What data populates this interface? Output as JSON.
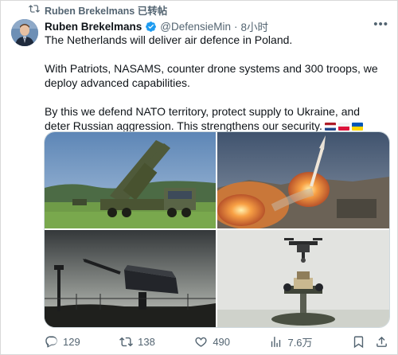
{
  "repost": {
    "label": "Ruben Brekelmans 已转帖"
  },
  "author": {
    "name": "Ruben Brekelmans",
    "handle": "@DefensieMin",
    "separator": "·",
    "time": "8小时"
  },
  "post": {
    "paragraphs": [
      "The Netherlands will deliver air defence in Poland.",
      "With Patriots, NASAMS, counter drone systems and 300 troops, we deploy advanced capabilities.",
      "By this we defend NATO territory, protect supply to Ukraine, and deter Russian aggression. This strengthens our security."
    ],
    "flags": [
      "flag-netherlands",
      "flag-poland",
      "flag-ukraine"
    ]
  },
  "actions": {
    "replies": "129",
    "reposts": "138",
    "likes": "490",
    "views": "7.6万"
  },
  "colors": {
    "text": "#0f1419",
    "secondary": "#536471",
    "verified": "#1d9bf0",
    "border": "#cfd9de"
  },
  "icons": {
    "repost": "repost-icon",
    "verified": "verified-badge-icon",
    "more": "more-icon",
    "reply": "reply-icon",
    "retweet": "retweet-icon",
    "like": "heart-icon",
    "views": "views-icon",
    "bookmark": "bookmark-icon",
    "share": "share-icon"
  }
}
